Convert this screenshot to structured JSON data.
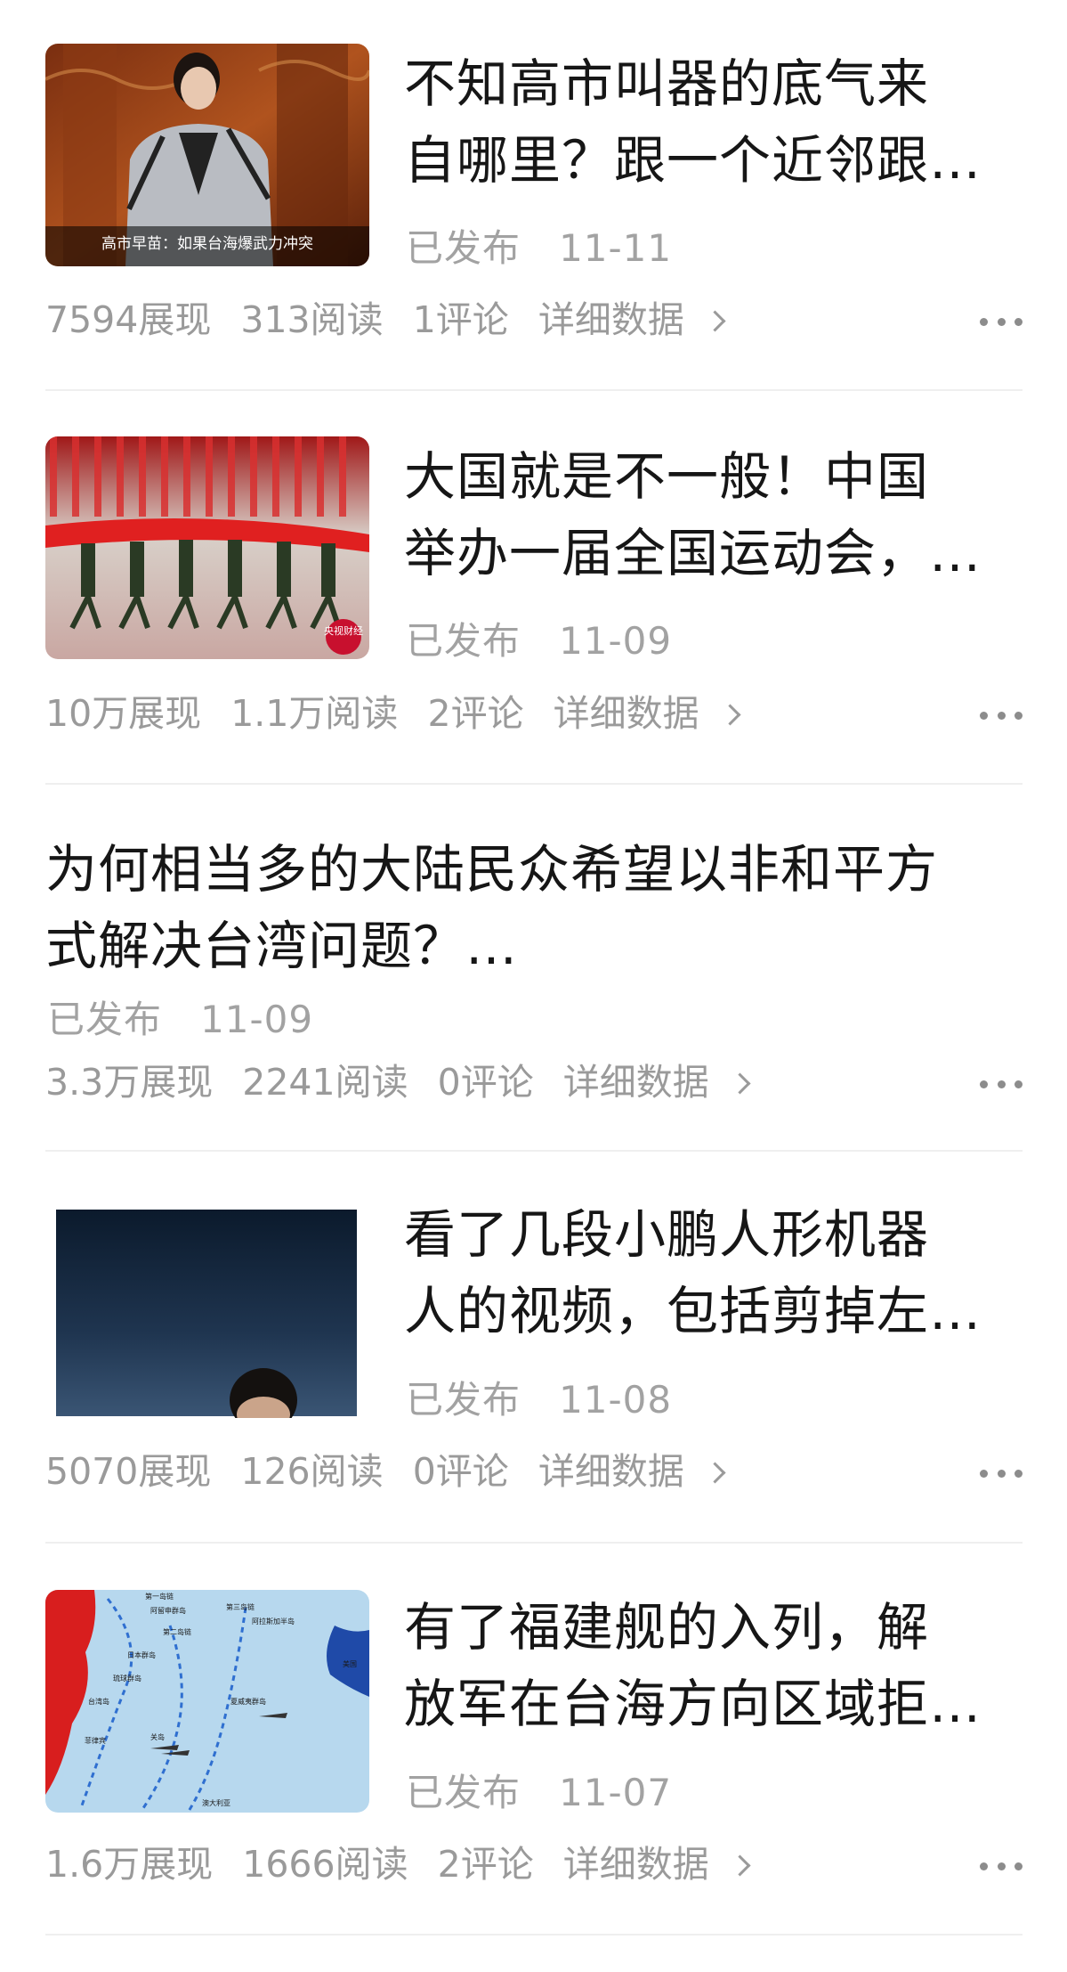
{
  "articles": [
    {
      "title_line1": "不知高市叫器的底气来",
      "title_line2": "自哪里？跟一个近邻跟…",
      "status": "已发布",
      "date": "11-11",
      "impressions": "7594展现",
      "reads": "313阅读",
      "comments": "1评论",
      "detail_label": "详细数据",
      "thumbnail_caption": "高市早苗：如果台海爆武力冲突"
    },
    {
      "title_line1": "大国就是不一般！中国",
      "title_line2": "举办一届全国运动会，…",
      "status": "已发布",
      "date": "11-09",
      "impressions": "10万展现",
      "reads": "1.1万阅读",
      "comments": "2评论",
      "detail_label": "详细数据",
      "thumbnail_badge": "央视财经"
    },
    {
      "title_line1": "为何相当多的大陆民众希望以非和平方",
      "title_line2": "式解决台湾问题？…",
      "status": "已发布",
      "date": "11-09",
      "impressions": "3.3万展现",
      "reads": "2241阅读",
      "comments": "0评论",
      "detail_label": "详细数据"
    },
    {
      "title_line1": "看了几段小鹏人形机器",
      "title_line2": "人的视频，包括剪掉左…",
      "status": "已发布",
      "date": "11-08",
      "impressions": "5070展现",
      "reads": "126阅读",
      "comments": "0评论",
      "detail_label": "详细数据"
    },
    {
      "title_line1": "有了福建舰的入列，解",
      "title_line2": "放军在台海方向区域拒…",
      "status": "已发布",
      "date": "11-07",
      "impressions": "1.6万展现",
      "reads": "1666阅读",
      "comments": "2评论",
      "detail_label": "详细数据",
      "map_labels": [
        "第一岛链",
        "第二岛链",
        "第三岛链",
        "关岛",
        "夏威夷群岛",
        "美国",
        "台湾岛",
        "日本群岛",
        "琉球群岛",
        "菲律宾",
        "阿留申群岛",
        "阿拉斯加半岛",
        "澳大利亚"
      ]
    }
  ],
  "colors": {
    "title": "#161616",
    "meta": "#9a9a9a",
    "divider": "#efefef",
    "background": "#ffffff"
  },
  "icons": [
    "chevron-right-icon",
    "more-dots-icon"
  ]
}
